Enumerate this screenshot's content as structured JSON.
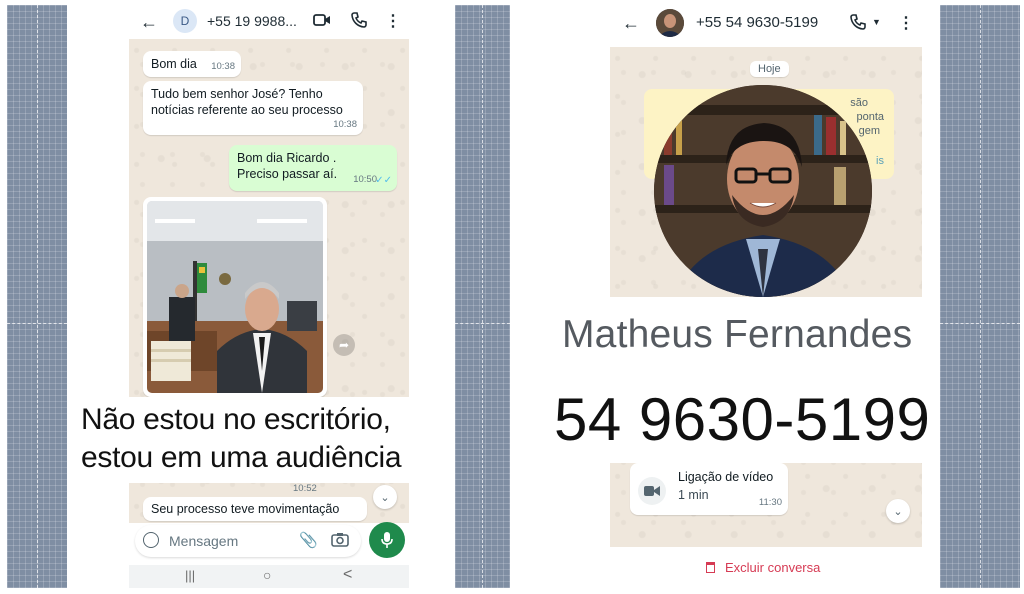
{
  "left_chat": {
    "header": {
      "avatar_letter": "D",
      "contact": "+55 19 9988..."
    },
    "messages": [
      {
        "text": "Bom dia",
        "time": "10:38",
        "direction": "in"
      },
      {
        "text_lines": [
          "Tudo bem senhor José? Tenho",
          "notícias referente ao seu processo"
        ],
        "time": "10:38",
        "direction": "in"
      },
      {
        "text_lines": [
          "Bom dia Ricardo .",
          "Preciso passar aí."
        ],
        "time": "10:50",
        "direction": "out",
        "read": true
      },
      {
        "time": "10:52",
        "direction": "in"
      },
      {
        "text": "Seu processo teve movimentação",
        "direction": "in"
      }
    ],
    "caption_overlay": [
      "Não estou no escritório,",
      "estou em uma audiência"
    ],
    "input_placeholder": "Mensagem",
    "nav_bar": [
      "|||",
      "○",
      "<"
    ]
  },
  "right_chat": {
    "header": {
      "contact": "+55 54 9630-5199"
    },
    "date_chip": "Hoje",
    "encryption_fragments": [
      "são",
      "ponta",
      "gem",
      "is"
    ],
    "name_overlay": "Matheus Fernandes",
    "phone_overlay": "54 9630-5199",
    "video_call": {
      "label": "Ligação de vídeo",
      "duration": "1 min",
      "time": "11:30"
    },
    "delete_chat": "Excluir conversa"
  },
  "colors": {
    "send_button": "#1f8a4c",
    "delete_red": "#d63b54",
    "read_ticks": "#53bdeb",
    "outgoing_bubble": "#d9fdd3",
    "chat_background": "#efe7dc",
    "side_panel": "#7f8ea3"
  }
}
